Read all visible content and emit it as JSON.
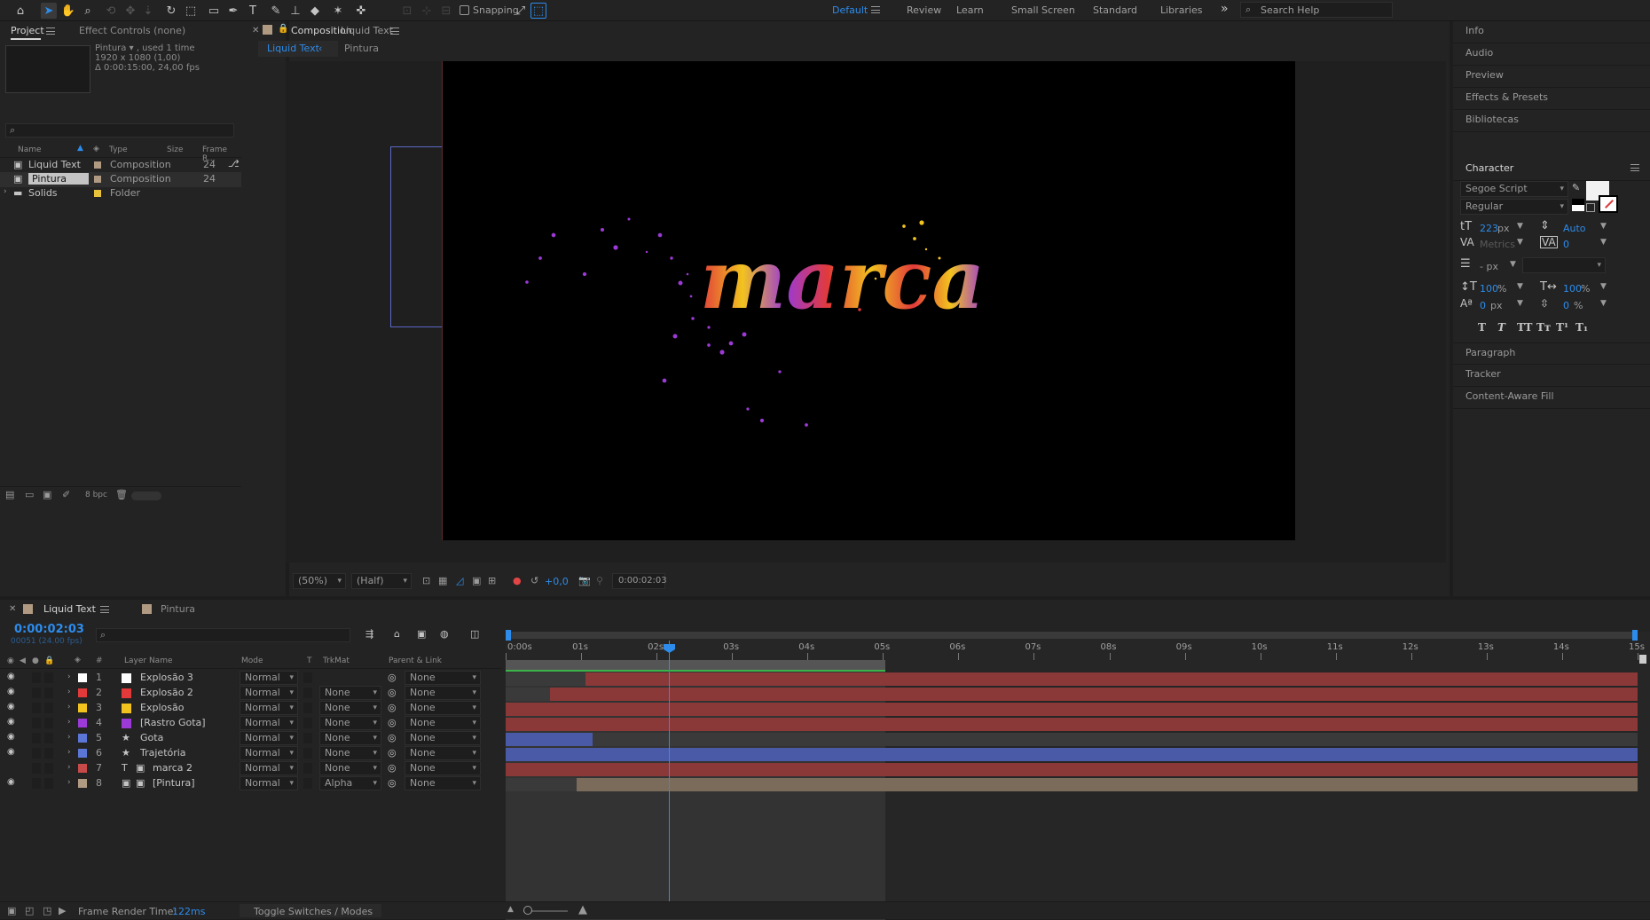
{
  "toolbar": {
    "snapping_label": "Snapping",
    "workspaces": [
      "Default",
      "Review",
      "Learn",
      "Small Screen",
      "Standard",
      "Libraries"
    ],
    "active_workspace": "Default",
    "search_placeholder": "Search Help"
  },
  "project": {
    "tabs": [
      "Project",
      "Effect Controls (none)"
    ],
    "selected_item": {
      "name": "Pintura",
      "used": ", used 1 time",
      "size": "1920 x 1080 (1,00)",
      "duration": "Δ 0:00:15:00, 24,00 fps"
    },
    "columns": [
      "Name",
      "Type",
      "Size",
      "Frame R..."
    ],
    "items": [
      {
        "name": "Liquid Text",
        "type": "Composition",
        "frame_rate": "24",
        "color": "#b09a82"
      },
      {
        "name": "Pintura",
        "type": "Composition",
        "frame_rate": "24",
        "color": "#b09a82"
      },
      {
        "name": "Solids",
        "type": "Folder",
        "frame_rate": "",
        "color": "#e8c23a"
      }
    ],
    "bpc": "8 bpc"
  },
  "viewer": {
    "comp_prefix": "Composition",
    "comp_name": "Liquid Text",
    "breadcrumbs": [
      "Liquid Text",
      "Pintura"
    ],
    "zoom": "(50%)",
    "resolution": "(Half)",
    "exposure": "+0,0",
    "timecode": "0:00:02:03",
    "canvas_text": "marca"
  },
  "right_panel": {
    "sections_top": [
      "Info",
      "Audio",
      "Preview",
      "Effects & Presets",
      "Bibliotecas"
    ],
    "character": {
      "title": "Character",
      "font": "Segoe Script",
      "style": "Regular",
      "size": "223",
      "size_unit": "px",
      "leading": "Auto",
      "kerning": "Metrics",
      "tracking": "0",
      "stroke_unit": "- px",
      "vscale": "100",
      "hscale": "100",
      "pct": "%",
      "baseline": "0",
      "baseline_unit": "px",
      "tsume": "0",
      "tsume_unit": "%",
      "format_buttons": [
        "T",
        "T",
        "TT",
        "Tт",
        "T¹",
        "T₁"
      ]
    },
    "sections_bottom": [
      "Paragraph",
      "Tracker",
      "Content-Aware Fill"
    ]
  },
  "timeline": {
    "tabs": [
      "Liquid Text",
      "Pintura"
    ],
    "timecode": "0:00:02:03",
    "frame_info": "00051 (24.00 fps)",
    "columns": [
      "#",
      "Layer Name",
      "Mode",
      "T",
      "TrkMat",
      "Parent & Link"
    ],
    "layers": [
      {
        "num": "1",
        "name": "Explosão 3",
        "mode": "Normal",
        "trkmat": "",
        "parent": "None",
        "color": "#ffffff",
        "kind": "solid"
      },
      {
        "num": "2",
        "name": "Explosão 2",
        "mode": "Normal",
        "trkmat": "None",
        "parent": "None",
        "color": "#e23a3a",
        "kind": "solid"
      },
      {
        "num": "3",
        "name": "Explosão",
        "mode": "Normal",
        "trkmat": "None",
        "parent": "None",
        "color": "#f2c31f",
        "kind": "solid"
      },
      {
        "num": "4",
        "name": "[Rastro Gota]",
        "mode": "Normal",
        "trkmat": "None",
        "parent": "None",
        "color": "#9b3ad6",
        "kind": "solid"
      },
      {
        "num": "5",
        "name": "Gota",
        "mode": "Normal",
        "trkmat": "None",
        "parent": "None",
        "color": "#5b76d6",
        "kind": "shape"
      },
      {
        "num": "6",
        "name": "Trajetória",
        "mode": "Normal",
        "trkmat": "None",
        "parent": "None",
        "color": "#5b76d6",
        "kind": "shape"
      },
      {
        "num": "7",
        "name": "marca 2",
        "mode": "Normal",
        "trkmat": "None",
        "parent": "None",
        "color": "#c64a4a",
        "kind": "text"
      },
      {
        "num": "8",
        "name": "[Pintura]",
        "mode": "Normal",
        "trkmat": "Alpha",
        "parent": "None",
        "color": "#b09a82",
        "kind": "comp"
      }
    ],
    "ruler": [
      "0:00s",
      "01s",
      "02s",
      "03s",
      "04s",
      "05s",
      "06s",
      "07s",
      "08s",
      "09s",
      "10s",
      "11s",
      "12s",
      "13s",
      "14s",
      "15s"
    ],
    "footer": {
      "render_label": "Frame Render Time:",
      "render_value": "122ms",
      "toggle_label": "Toggle Switches / Modes"
    }
  }
}
